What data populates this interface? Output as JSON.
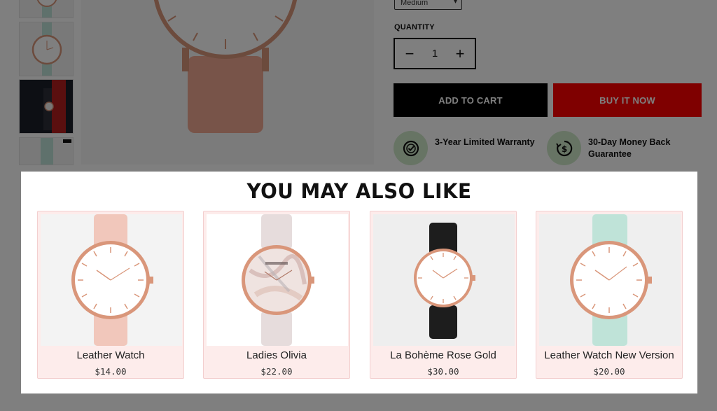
{
  "product_page": {
    "variant_select_value": "Medium",
    "quantity": {
      "label": "QUANTITY",
      "value": "1",
      "decrease_symbol": "−",
      "increase_symbol": "+"
    },
    "buttons": {
      "add_to_cart": "ADD TO CART",
      "buy_it_now": "BUY IT NOW"
    },
    "badges": [
      {
        "icon": "warranty-check-icon",
        "text": "3-Year Limited Warranty"
      },
      {
        "icon": "money-back-icon",
        "text": "30-Day Money Back Guarantee"
      }
    ]
  },
  "related": {
    "title": "YOU MAY ALSO LIKE",
    "products": [
      {
        "name": "Leather Watch",
        "price": "$14.00",
        "strap_color": "#f1c7bb",
        "face_color": "#ffffff"
      },
      {
        "name": "Ladies Olivia",
        "price": "$22.00",
        "strap_color": "#e6dcdc",
        "face_color": "#efe3e0"
      },
      {
        "name": "La Bohème Rose Gold",
        "price": "$30.00",
        "strap_color": "#1d1d1d",
        "face_color": "#ffffff"
      },
      {
        "name": "Leather Watch New Version",
        "price": "$20.00",
        "strap_color": "#bfe3d8",
        "face_color": "#ffffff"
      }
    ]
  },
  "colors": {
    "buy_now": "#ff0000",
    "add_to_cart": "#000000",
    "badge_bg": "#cfe8c8",
    "card_bg": "#fdeceb",
    "rose_gold": "#d9967a"
  }
}
